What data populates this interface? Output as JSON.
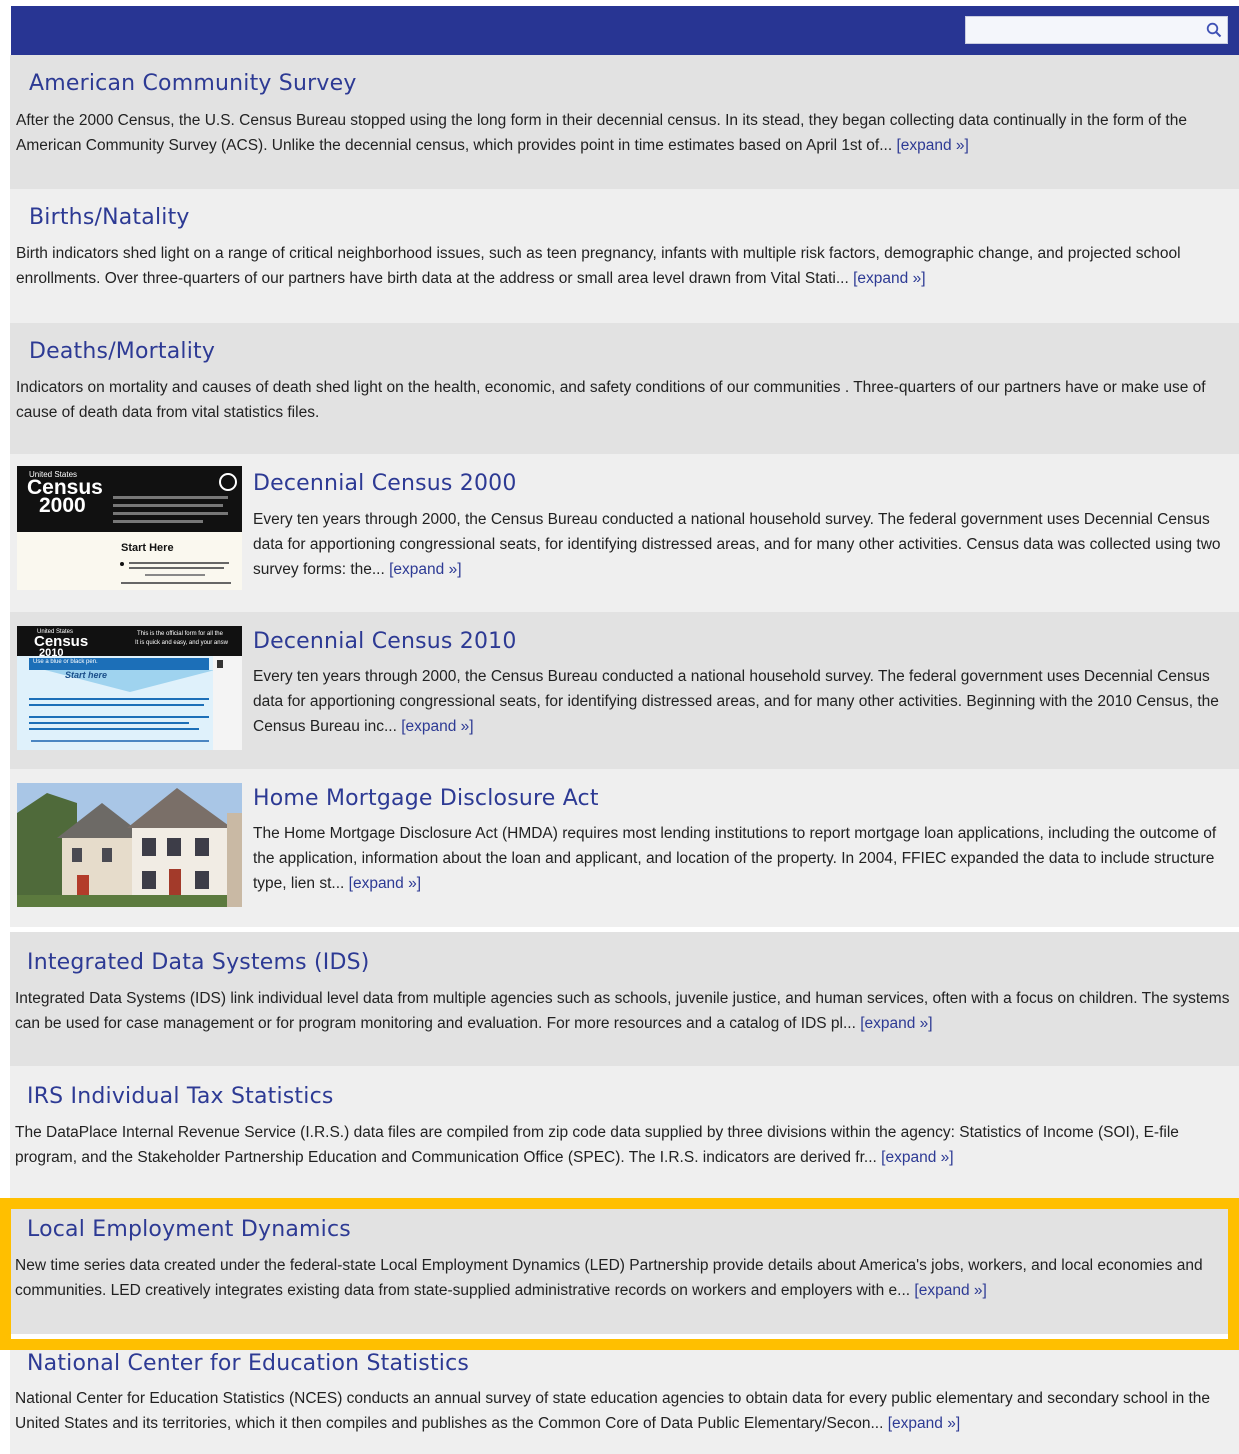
{
  "search": {
    "placeholder": "",
    "value": ""
  },
  "colors": {
    "header": "#283593",
    "link": "#2d3a94",
    "highlight": "#ffbf00"
  },
  "expand_label": "[expand »]",
  "entries": [
    {
      "title": "American Community Survey",
      "description": "After the 2000 Census, the U.S. Census Bureau stopped using the long form in their decennial census. In its stead, they began collecting data continually in the form of the American Community Survey (ACS). Unlike the decennial census, which provides point in time estimates based on April 1st of...",
      "has_expand": true
    },
    {
      "title": "Births/Natality",
      "description": "Birth indicators shed light on a range of critical neighborhood issues, such as teen pregnancy, infants with multiple risk factors, demographic change, and projected school enrollments. Over three-quarters of our partners have birth data at the address or small area level drawn from Vital Stati...",
      "has_expand": true
    },
    {
      "title": "Deaths/Mortality",
      "description": "Indicators on mortality and causes of death shed light on the health, economic, and safety conditions of our communities . Three-quarters of our partners have or make use of cause of death data from vital statistics files.",
      "has_expand": false
    },
    {
      "title": "Decennial Census 2000",
      "description": "Every ten years through 2000, the Census Bureau conducted a national household survey. The federal government uses Decennial Census data for apportioning congressional seats, for identifying distressed areas, and for many other activities. Census data was collected using two survey forms: the...",
      "has_expand": true,
      "thumb": {
        "brand": "United States",
        "word": "Census",
        "year": "2000",
        "start": "Start Here"
      }
    },
    {
      "title": "Decennial Census 2010",
      "description": "Every ten years through 2000, the Census Bureau conducted a national household survey. The federal government uses Decennial Census data for apportioning congressional seats, for identifying distressed areas, and for many other activities. Beginning with the 2010 Census, the Census Bureau inc...",
      "has_expand": true,
      "thumb": {
        "brand": "United States",
        "word": "Census",
        "year": "2010",
        "blurb": "This is the official form for all the",
        "blurb2": "It is quick and easy, and your answ",
        "pen": "Use a blue or black pen.",
        "start": "Start here"
      }
    },
    {
      "title": "Home Mortgage Disclosure Act",
      "description": "The Home Mortgage Disclosure Act (HMDA) requires most lending institutions to report mortgage loan applications, including the outcome of the application, information about the loan and applicant, and location of the property. In 2004, FFIEC expanded the data to include structure type, lien st...",
      "has_expand": true
    },
    {
      "title": "Integrated Data Systems (IDS)",
      "description": "Integrated Data Systems (IDS) link individual level data from multiple agencies such as schools, juvenile justice, and human services, often with a focus on children. The systems can be used for case management or for program monitoring and evaluation. For more resources and a catalog of IDS pl...",
      "has_expand": true
    },
    {
      "title": "IRS Individual Tax Statistics",
      "description": "The DataPlace Internal Revenue Service (I.R.S.) data files are compiled from zip code data supplied by three divisions within the agency: Statistics of Income (SOI), E-file program, and the Stakeholder Partnership Education and Communication Office (SPEC). The I.R.S. indicators are derived fr...",
      "has_expand": true
    },
    {
      "title": "Local Employment Dynamics",
      "description": "New time series data created under the federal-state Local Employment Dynamics (LED) Partnership provide details about America's jobs, workers, and local economies and communities. LED creatively integrates existing data from state-supplied administrative records on workers and employers with e...",
      "has_expand": true,
      "highlighted": true
    },
    {
      "title": "National Center for Education Statistics",
      "description": "National Center for Education Statistics (NCES) conducts an annual survey of state education agencies to obtain data for every public elementary and secondary school in the United States and its territories, which it then compiles and publishes as the Common Core of Data Public Elementary/Secon...",
      "has_expand": true
    }
  ]
}
